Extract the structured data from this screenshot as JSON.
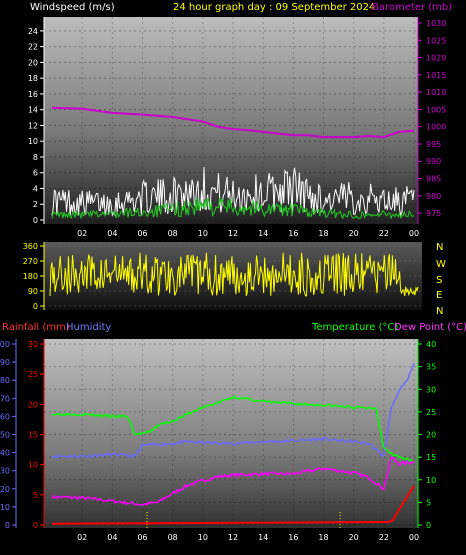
{
  "header": {
    "left_label": "Windspeed (m/s)",
    "center_label": "24 hour graph day : 09 September 2024",
    "right_label": "Barometer (mb)"
  },
  "wind_dir_labels": [
    "N",
    "W",
    "S",
    "E",
    "N"
  ],
  "bottom_header": {
    "rain_label": "Rainfall (mm)",
    "humidity_label": "Humidity",
    "temp_label": "Temperature (°C)",
    "dew_label": "Dew Point (°C)"
  },
  "colors": {
    "background": "#000000",
    "wind_axis": "#ffffff",
    "baro": "#cc00cc",
    "gust": "#ffffff",
    "wind_avg": "#22cc22",
    "wind_dir": "#ffff00",
    "title": "#ffff00",
    "rain": "#ff0000",
    "humidity": "#6a6aff",
    "temperature": "#00ff00",
    "dewpoint": "#ff00ff"
  },
  "chart_data": [
    {
      "type": "line",
      "name": "wind-barometer",
      "x_ticks": [
        "02",
        "04",
        "06",
        "08",
        "10",
        "12",
        "14",
        "16",
        "18",
        "20",
        "22",
        "00"
      ],
      "y_left_ticks": [
        0,
        2,
        4,
        6,
        8,
        10,
        12,
        14,
        16,
        18,
        20,
        22,
        24
      ],
      "y_left_range": [
        0,
        25
      ],
      "y_right_ticks": [
        975,
        980,
        985,
        990,
        995,
        1000,
        1005,
        1010,
        1015,
        1020,
        1025,
        1030
      ],
      "y_right_range": [
        973,
        1030
      ],
      "barometer": {
        "x": [
          0,
          2,
          4,
          6,
          8,
          10,
          11,
          12,
          13,
          14,
          15,
          16,
          17,
          18,
          20,
          21,
          22,
          23,
          24
        ],
        "y": [
          1005.5,
          1005.2,
          1004,
          1003.5,
          1002.8,
          1001.5,
          1000,
          999.3,
          999.0,
          998.5,
          998.0,
          997.5,
          997.5,
          997.0,
          997.0,
          997.3,
          997.0,
          998.5,
          998.8
        ]
      },
      "gust_envelope": {
        "x": [
          0,
          2,
          4,
          6,
          8,
          9,
          10,
          11,
          12,
          14,
          15,
          16,
          17,
          18,
          20,
          22,
          24
        ],
        "y": [
          4,
          3.5,
          3.5,
          4.5,
          5,
          6,
          6.5,
          5.5,
          5,
          5.5,
          6,
          6.5,
          5,
          4,
          4.5,
          4,
          4
        ]
      },
      "avg_envelope": {
        "x": [
          0,
          2,
          4,
          6,
          8,
          10,
          12,
          14,
          16,
          18,
          20,
          22,
          24
        ],
        "y": [
          1,
          1,
          1.2,
          1.5,
          2,
          2.8,
          2.5,
          2.2,
          2,
          1.3,
          1,
          1.1,
          1
        ]
      }
    },
    {
      "type": "line",
      "name": "wind-direction",
      "y_ticks": [
        0,
        90,
        180,
        270,
        360
      ],
      "y_range": [
        0,
        360
      ],
      "series_note": "",
      "direction_band": {
        "low": 60,
        "high": 320
      }
    },
    {
      "type": "line",
      "name": "temp-humidity-rain",
      "x_ticks": [
        "02",
        "04",
        "06",
        "08",
        "10",
        "12",
        "14",
        "16",
        "18",
        "20",
        "22",
        "00"
      ],
      "y_humidity_ticks": [
        0,
        10,
        20,
        30,
        40,
        50,
        60,
        70,
        80,
        90,
        100
      ],
      "y_rain_ticks": [
        0,
        5,
        10,
        15,
        20,
        25,
        30
      ],
      "y_temp_ticks": [
        0,
        5,
        10,
        15,
        20,
        25,
        30,
        35,
        40
      ],
      "temperature": {
        "x": [
          0,
          2,
          4,
          5,
          5.5,
          6.5,
          7,
          8,
          9,
          10,
          11,
          12,
          13,
          14,
          16,
          18,
          20,
          21.5,
          22,
          22.5,
          23,
          24
        ],
        "y": [
          24.5,
          24.5,
          24,
          24,
          20,
          20.5,
          22,
          23,
          24.5,
          26,
          27,
          28.3,
          27.8,
          27.3,
          26.8,
          26.5,
          26,
          25.8,
          17,
          16,
          15,
          14
        ]
      },
      "dewpoint": {
        "x": [
          0,
          2,
          4,
          6,
          7,
          8,
          9,
          10,
          11,
          12,
          14,
          16,
          18,
          20,
          21,
          22,
          22.5,
          23,
          24
        ],
        "y": [
          6.2,
          6.0,
          5.3,
          4.5,
          5,
          7,
          8.8,
          9.8,
          10.7,
          11,
          11.3,
          11.3,
          12.5,
          11.5,
          10.5,
          8,
          15,
          13.5,
          14
        ]
      },
      "humidity": {
        "x": [
          0,
          2,
          4,
          5.5,
          6,
          8,
          9,
          10,
          12,
          14,
          16,
          18,
          20,
          21,
          22,
          22.5,
          23,
          23.5,
          24
        ],
        "y": [
          38,
          38,
          39,
          38,
          44,
          45,
          46,
          45.5,
          45,
          46,
          46.5,
          47.5,
          46,
          45,
          38,
          65,
          74,
          79,
          89
        ]
      },
      "rainfall": {
        "x": [
          0,
          22.3,
          22.6,
          23,
          23.5,
          24
        ],
        "y": [
          0.2,
          0.5,
          0.8,
          2.5,
          4.5,
          6.5
        ]
      },
      "sun_markers_hours": [
        6.3,
        19.1
      ]
    }
  ]
}
